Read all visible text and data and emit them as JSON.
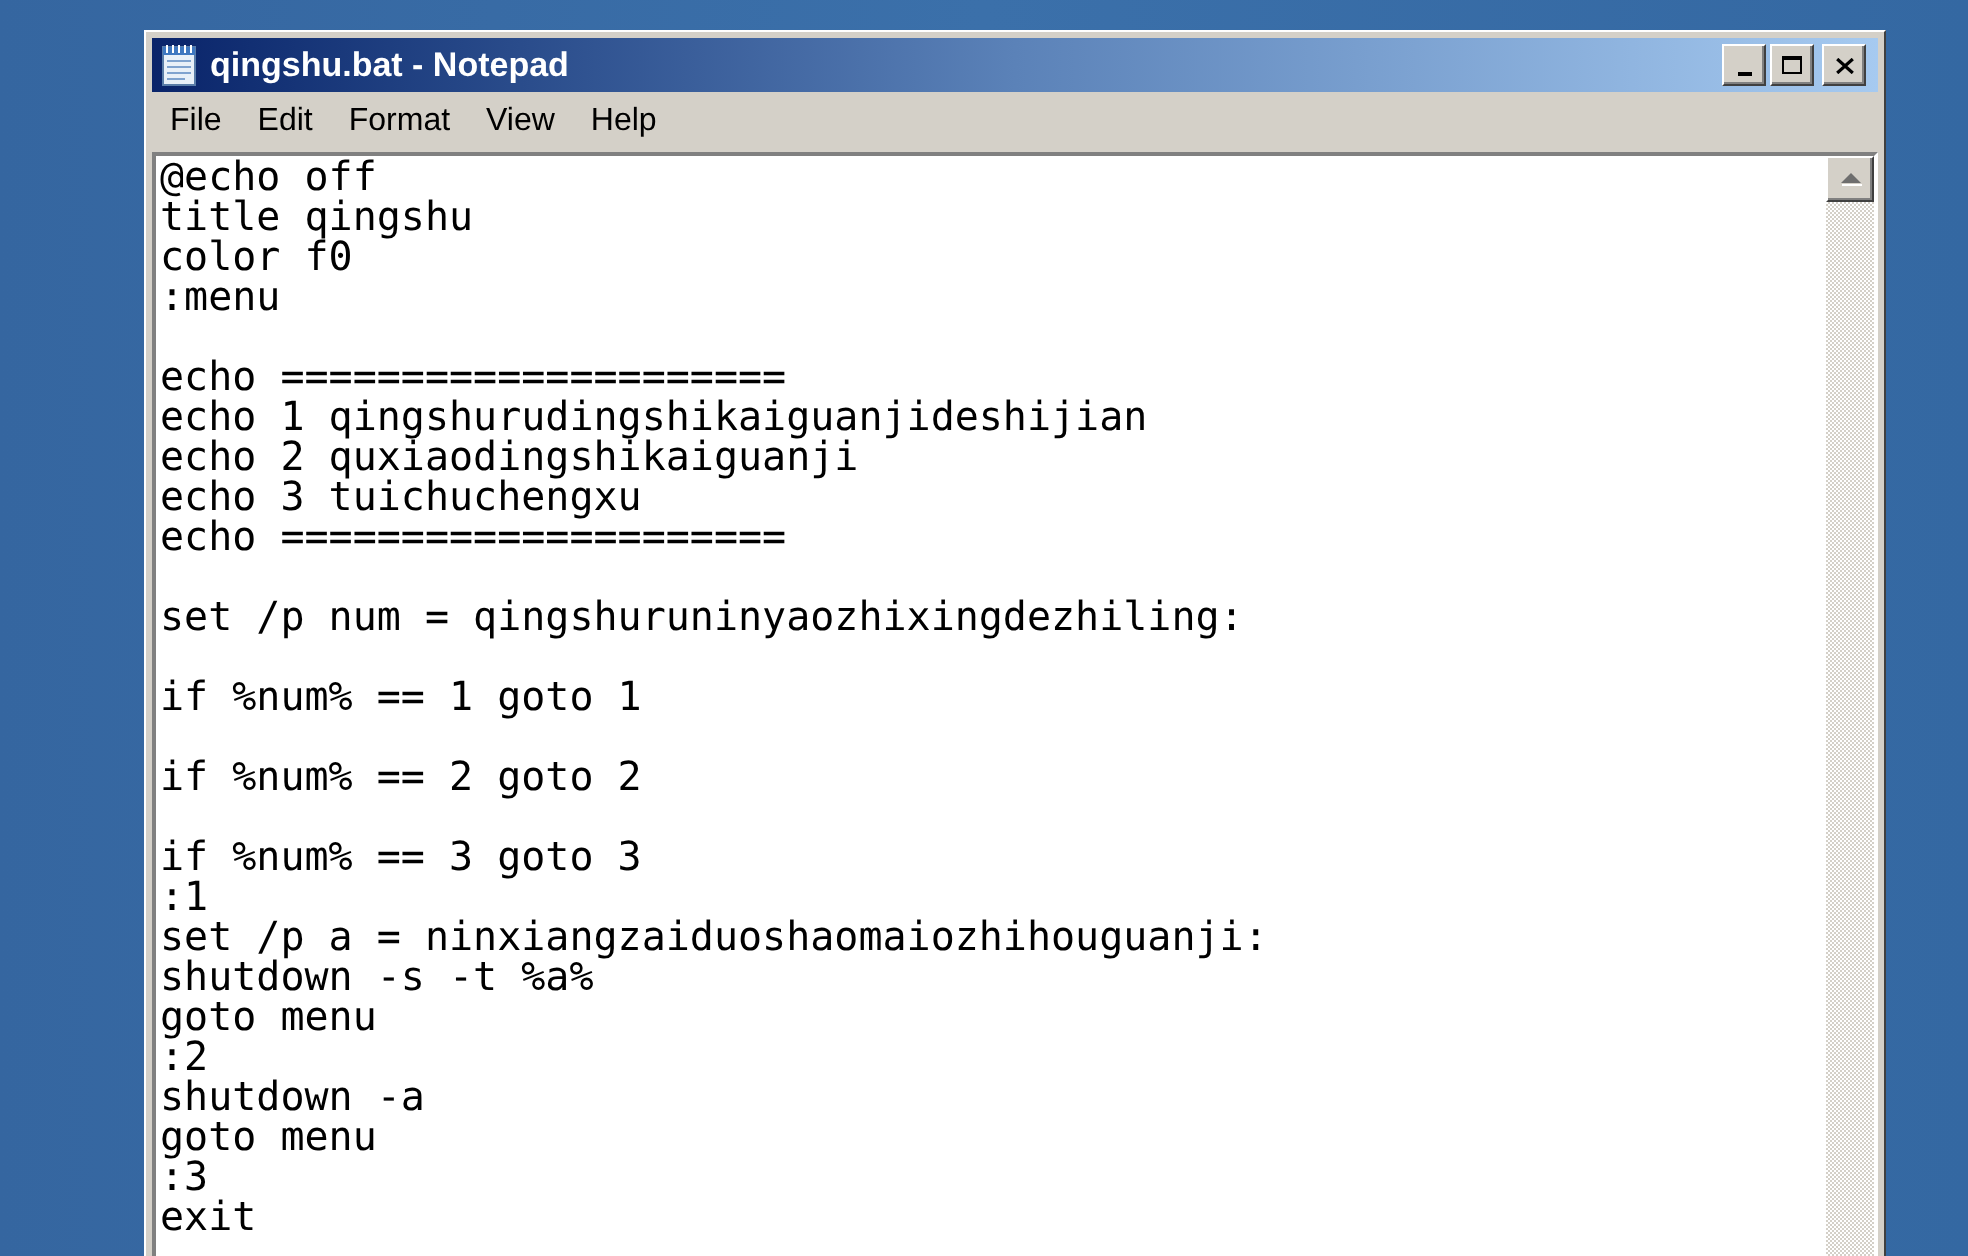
{
  "window": {
    "title": "qingshu.bat - Notepad"
  },
  "menu": [
    "File",
    "Edit",
    "Format",
    "View",
    "Help"
  ],
  "editor": {
    "lines": [
      {
        "kind": "code",
        "text": "@echo off"
      },
      {
        "kind": "code",
        "text": "title qingshu"
      },
      {
        "kind": "code",
        "text": "color f0"
      },
      {
        "kind": "code",
        "text": ":menu"
      },
      {
        "kind": "blank"
      },
      {
        "kind": "code",
        "text": "echo ====================="
      },
      {
        "kind": "code",
        "text": "echo 1 qingshurudingshikaiguanjideshijian"
      },
      {
        "kind": "code",
        "text": "echo 2 quxiaodingshikaiguanji"
      },
      {
        "kind": "code",
        "text": "echo 3 tuichuchengxu"
      },
      {
        "kind": "code",
        "text": "echo ====================="
      },
      {
        "kind": "blank"
      },
      {
        "kind": "code",
        "text": "set /p num = qingshuruninyaozhixingdezhiling:"
      },
      {
        "kind": "blank"
      },
      {
        "kind": "code",
        "text": "if %num% == 1 goto 1"
      },
      {
        "kind": "blank"
      },
      {
        "kind": "code",
        "text": "if %num% == 2 goto 2"
      },
      {
        "kind": "blank"
      },
      {
        "kind": "code",
        "text": "if %num% == 3 goto 3"
      },
      {
        "kind": "code",
        "text": ":1"
      },
      {
        "kind": "code",
        "text": "set /p a = ninxiangzaiduoshaomaiozhihouguanji:"
      },
      {
        "kind": "code",
        "text": "shutdown -s -t %a%"
      },
      {
        "kind": "code",
        "text": "goto menu"
      },
      {
        "kind": "code",
        "text": ":2"
      },
      {
        "kind": "code",
        "text": "shutdown -a"
      },
      {
        "kind": "code",
        "text": "goto menu"
      },
      {
        "kind": "code",
        "text": ":3"
      },
      {
        "kind": "code",
        "text": "exit"
      }
    ]
  }
}
